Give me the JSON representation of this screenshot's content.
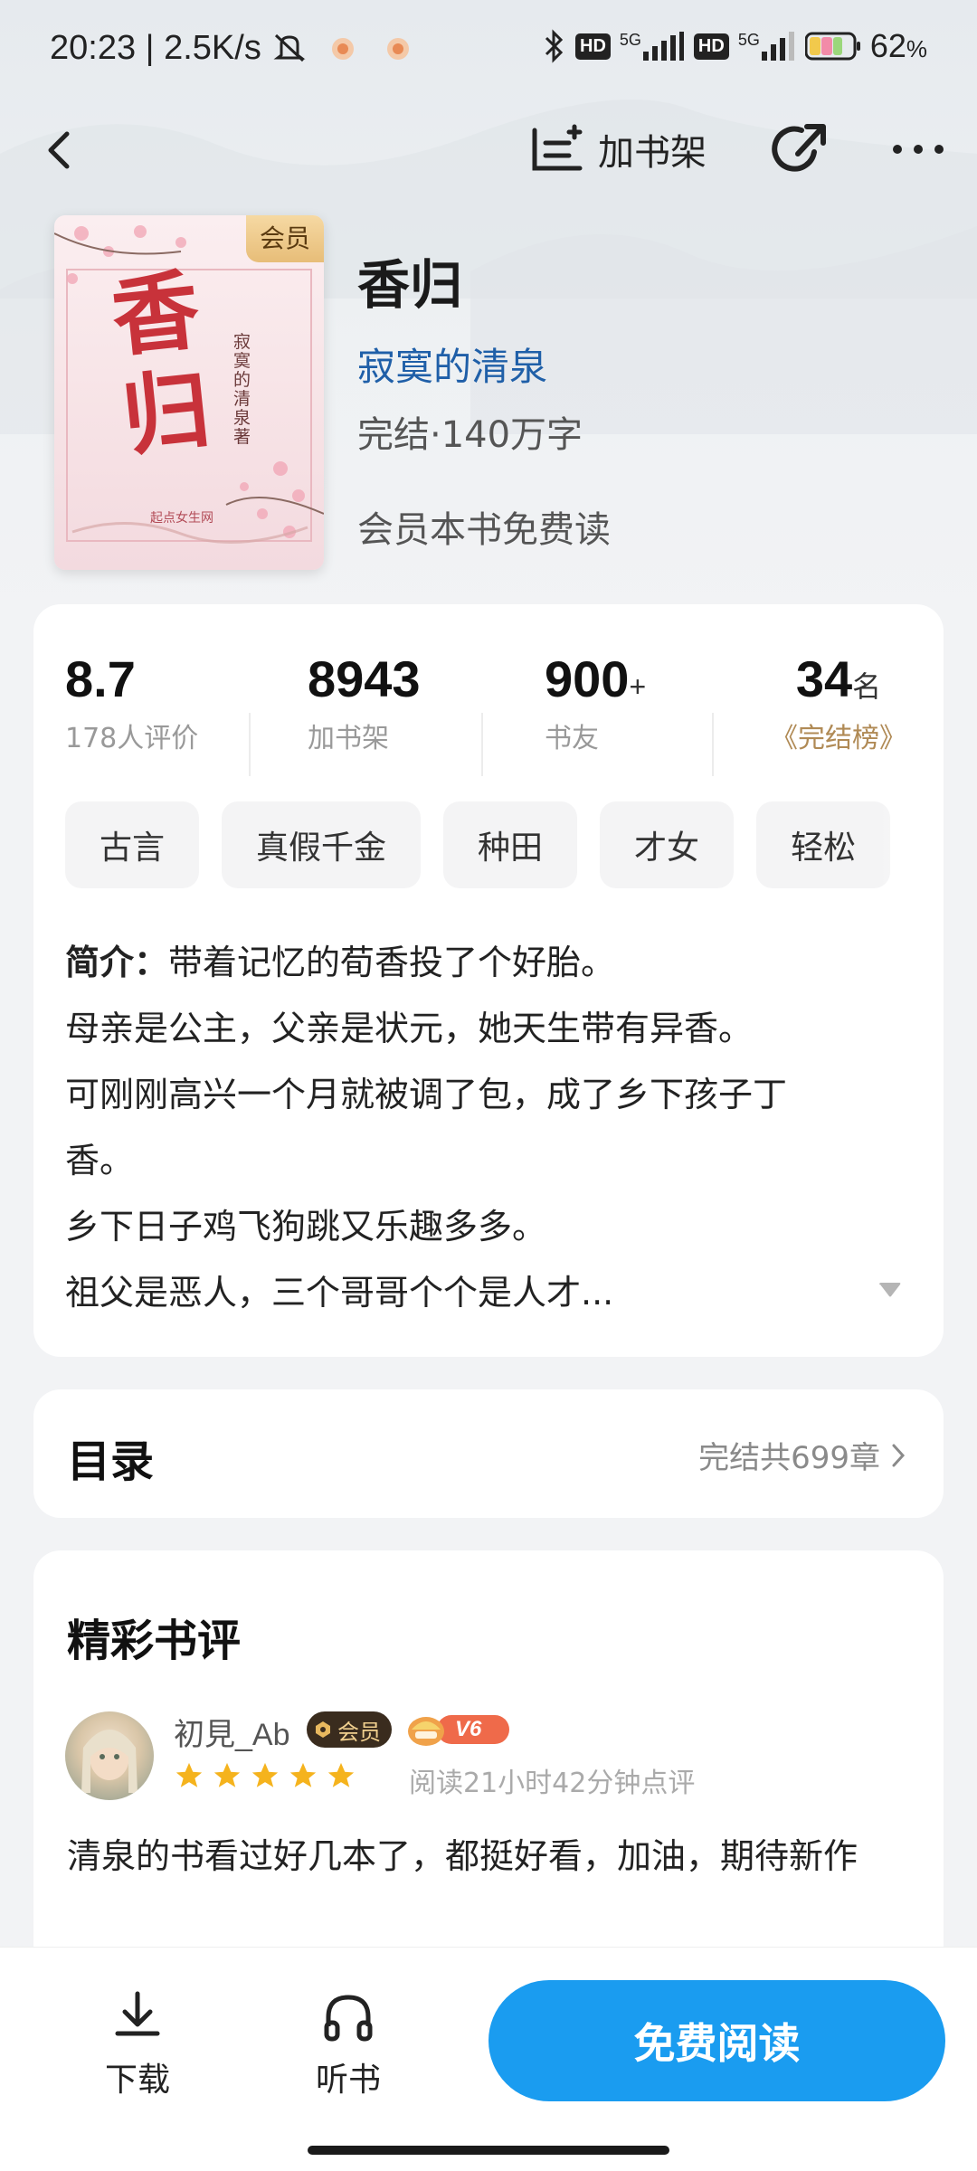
{
  "status_bar": {
    "time": "20:23",
    "speed": "2.5K/s",
    "network1": "5G",
    "network2": "5G",
    "hd1": "HD",
    "hd2": "HD",
    "battery": "62",
    "battery_unit": "%",
    "icons": [
      "mute-icon",
      "app-notification-icon",
      "app-notification-icon",
      "bluetooth-icon",
      "signal-icon",
      "battery-icon"
    ]
  },
  "nav": {
    "back_icon": "chevron-left-icon",
    "add_shelf_label": "加书架",
    "add_shelf_icon": "bookshelf-add-icon",
    "share_icon": "share-icon",
    "more_icon": "more-icon"
  },
  "book": {
    "title": "香归",
    "author": "寂寞的清泉",
    "meta": "完结·140万字",
    "member_note": "会员本书免费读",
    "cover_badge": "会员",
    "cover_title": "香归",
    "cover_author": "寂寞的清泉",
    "cover_author_suffix": "著",
    "cover_publisher": "起点女生网"
  },
  "stats": [
    {
      "value": "8.7",
      "suffix": "",
      "label": "178人评价"
    },
    {
      "value": "8943",
      "suffix": "",
      "label": "加书架"
    },
    {
      "value": "900",
      "suffix": "+",
      "label": "书友"
    },
    {
      "value": "34",
      "suffix": "名",
      "label": "完结榜"
    }
  ],
  "tags": [
    "古言",
    "真假千金",
    "种田",
    "才女",
    "轻松"
  ],
  "intro": {
    "label": "简介：",
    "lines": [
      "带着记忆的荀香投了个好胎。",
      "母亲是公主，父亲是状元，她天生带有异香。",
      "可刚刚高兴一个月就被调了包，成了乡下孩子丁",
      "香。",
      "乡下日子鸡飞狗跳又乐趣多多。",
      "祖父是恶人，三个哥哥个个是人才..."
    ]
  },
  "toc": {
    "title": "目录",
    "summary": "完结共699章"
  },
  "reviews": {
    "title": "精彩书评",
    "items": [
      {
        "user": "初見_Ab",
        "member_badge": "会员",
        "level": "V6",
        "rating": 5,
        "meta": "阅读21小时42分钟点评",
        "text": "清泉的书看过好几本了，都挺好看，加油，期待新作"
      }
    ]
  },
  "bottom_bar": {
    "download_label": "下载",
    "listen_label": "听书",
    "read_label": "免费阅读"
  },
  "colors": {
    "accent": "#1a9cf0",
    "author_link": "#1f5fa8",
    "star": "#f5b31d",
    "rank_gold": "#b08a55"
  }
}
